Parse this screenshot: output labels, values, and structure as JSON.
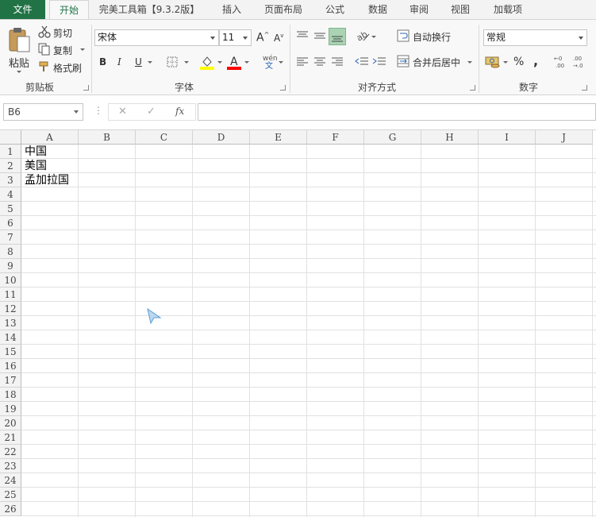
{
  "tabs": [
    "文件",
    "开始",
    "完美工具箱【9.3.2版】",
    "插入",
    "页面布局",
    "公式",
    "数据",
    "审阅",
    "视图",
    "加载项"
  ],
  "clipboard": {
    "paste": "粘贴",
    "cut": "剪切",
    "copy": "复制",
    "format_painter": "格式刷",
    "label": "剪贴板"
  },
  "font": {
    "name": "宋体",
    "size": "11",
    "bold": "B",
    "italic": "I",
    "underline": "U",
    "label": "字体",
    "phonetic": "wén"
  },
  "alignment": {
    "wrap": "自动换行",
    "merge": "合并后居中",
    "label": "对齐方式"
  },
  "number": {
    "format": "常规",
    "percent": "%",
    "comma": ",",
    "label": "数字"
  },
  "formula_bar": {
    "name_box": "B6",
    "cancel": "✕",
    "enter": "✓",
    "fx": "fx"
  },
  "sheet": {
    "columns": [
      "A",
      "B",
      "C",
      "D",
      "E",
      "F",
      "G",
      "H",
      "I",
      "J"
    ],
    "rows": [
      "1",
      "2",
      "3",
      "4",
      "5",
      "6",
      "7",
      "8",
      "9",
      "10",
      "11",
      "12",
      "13",
      "14",
      "15",
      "16",
      "17",
      "18",
      "19",
      "20",
      "21",
      "22",
      "23",
      "24",
      "25",
      "26"
    ],
    "cells": {
      "A1": "中国",
      "A2": "美国",
      "A3": "孟加拉国"
    }
  },
  "colors": {
    "accent": "#217346",
    "highlight_bar": "#ffff00",
    "font_color_bar": "#ff0000"
  }
}
